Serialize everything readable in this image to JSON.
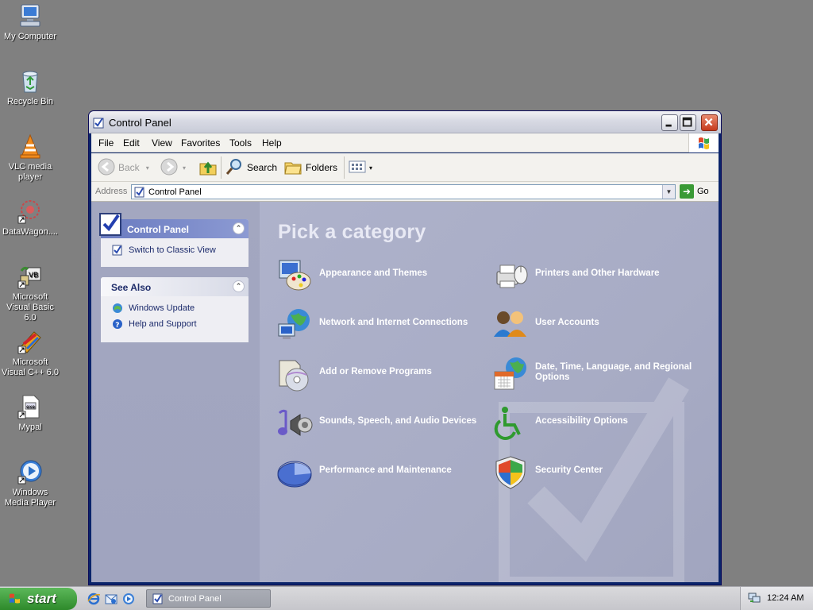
{
  "desktop": {
    "icons": [
      {
        "label": "My Computer",
        "icon": "my-computer-icon"
      },
      {
        "label": "Recycle Bin",
        "icon": "recycle-bin-icon"
      },
      {
        "label": "VLC media player",
        "icon": "vlc-icon"
      },
      {
        "label": "DataWagon....",
        "icon": "datawagon-icon"
      },
      {
        "label": "Microsoft Visual Basic 6.0",
        "icon": "visual-basic-icon"
      },
      {
        "label": "Microsoft Visual C++ 6.0",
        "icon": "visual-cpp-icon"
      },
      {
        "label": "Mypal",
        "icon": "mypal-icon"
      },
      {
        "label": "Windows Media Player",
        "icon": "windows-media-player-icon"
      }
    ]
  },
  "window": {
    "title": "Control Panel",
    "menu": [
      "File",
      "Edit",
      "View",
      "Favorites",
      "Tools",
      "Help"
    ],
    "toolbar": {
      "back": "Back",
      "search": "Search",
      "folders": "Folders"
    },
    "address": {
      "label": "Address",
      "value": "Control Panel",
      "go": "Go"
    }
  },
  "left_pane": {
    "control_panel": {
      "title": "Control Panel",
      "switch_view": "Switch to Classic View"
    },
    "see_also": {
      "title": "See Also",
      "items": [
        "Windows Update",
        "Help and Support"
      ]
    }
  },
  "main": {
    "heading": "Pick a category",
    "categories": [
      {
        "label": "Appearance and Themes",
        "icon": "appearance-themes-icon"
      },
      {
        "label": "Printers and Other Hardware",
        "icon": "printers-hardware-icon"
      },
      {
        "label": "Network and Internet Connections",
        "icon": "network-internet-icon"
      },
      {
        "label": "User Accounts",
        "icon": "user-accounts-icon"
      },
      {
        "label": "Add or Remove Programs",
        "icon": "add-remove-programs-icon"
      },
      {
        "label": "Date, Time, Language, and Regional Options",
        "icon": "date-time-language-icon"
      },
      {
        "label": "Sounds, Speech, and Audio Devices",
        "icon": "sounds-audio-icon"
      },
      {
        "label": "Accessibility Options",
        "icon": "accessibility-icon"
      },
      {
        "label": "Performance and Maintenance",
        "icon": "performance-maintenance-icon"
      },
      {
        "label": "Security Center",
        "icon": "security-center-icon"
      }
    ]
  },
  "taskbar": {
    "start": "start",
    "task_button": "Control Panel",
    "clock": "12:24 AM"
  }
}
